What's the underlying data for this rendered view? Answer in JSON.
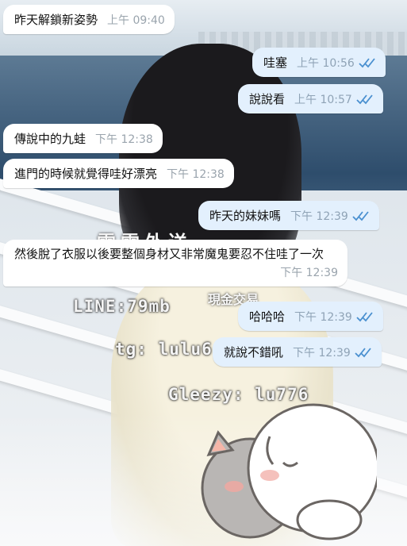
{
  "watermarks": {
    "top": "雲雲外送",
    "mid": "現金交易",
    "line": "LINE:79mb",
    "tg": "tg: lulu6",
    "gleezy": "Gleezy: lu776"
  },
  "messages": [
    {
      "text": "昨天解鎖新姿勢",
      "time": "上午 09:40",
      "dir": "in"
    },
    {
      "text": "哇塞",
      "time": "上午 10:56",
      "dir": "out",
      "status": "read"
    },
    {
      "text": "說說看",
      "time": "上午 10:57",
      "dir": "out",
      "status": "read"
    },
    {
      "text": "傳說中的九蛙",
      "time": "下午 12:38",
      "dir": "in"
    },
    {
      "text": "進門的時候就覺得哇好漂亮",
      "time": "下午 12:38",
      "dir": "in"
    },
    {
      "text": "昨天的妹妹嗎",
      "time": "下午 12:39",
      "dir": "out",
      "status": "read"
    },
    {
      "text": "然後脫了衣服以後要整個身材又非常魔鬼要忍不住哇了一次",
      "time": "下午 12:39",
      "dir": "in"
    },
    {
      "text": "哈哈哈",
      "time": "下午 12:39",
      "dir": "out",
      "status": "read"
    },
    {
      "text": "就說不錯吼",
      "time": "下午 12:39",
      "dir": "out",
      "status": "read"
    }
  ],
  "colors": {
    "incoming_bubble": "#ffffff",
    "outgoing_bubble": "#e3f0fd",
    "read_check": "#4a90d0"
  },
  "icons": {
    "read_receipt": "double-check-icon",
    "sticker": "cat-sticker"
  }
}
